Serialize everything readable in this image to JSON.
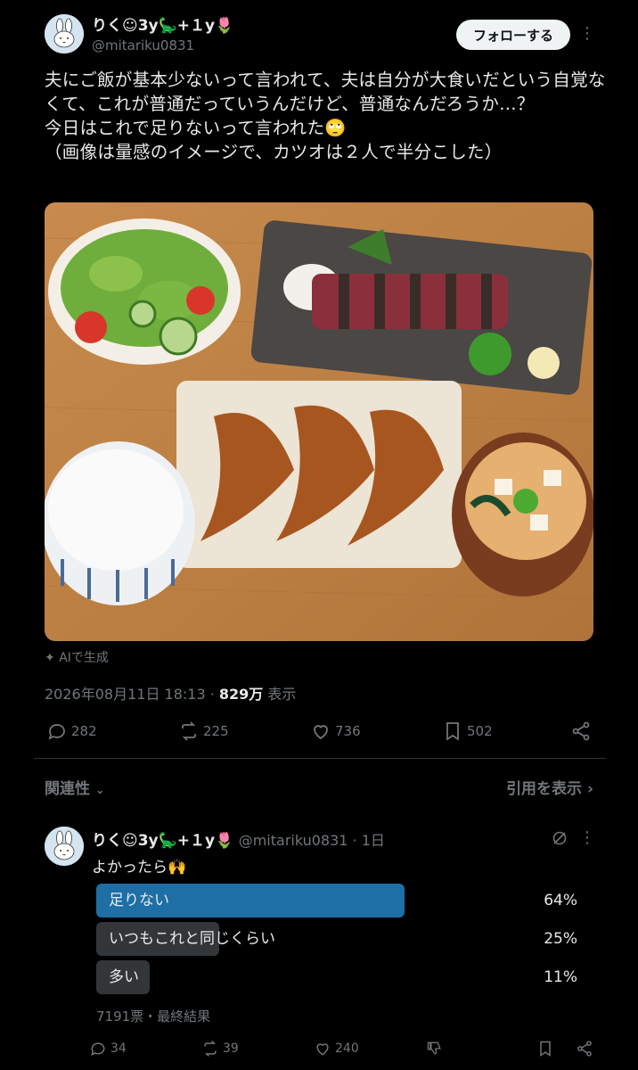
{
  "author": {
    "display_name": "りく☺︎3y🦕+１y🌷",
    "handle": "@mitariku0831",
    "follow_label": "フォローする"
  },
  "tweet": {
    "text": "夫にご飯が基本少ないって言われて、夫は自分が大食いだという自覚なくて、これが普通だっていうんだけど、普通なんだろうか…？\n今日はこれで足りないって言われた🙄\n（画像は量感のイメージで、カツオは２人で半分こした）",
    "ai_label": "AIで生成",
    "timestamp": "2026年08月11日 18:13",
    "views_count": "829万",
    "views_label": "表示",
    "stats": {
      "replies": "282",
      "reposts": "225",
      "likes": "736",
      "bookmarks": "502"
    }
  },
  "replies_section": {
    "sort_label": "関連性",
    "quotes_label": "引用を表示"
  },
  "reply": {
    "display_name": "りく☺︎3y🦕+１y🌷",
    "handle": "@mitariku0831",
    "time": "1日",
    "text": "よかったら🙌",
    "poll": {
      "options": [
        {
          "label": "足りない",
          "percent": "64%",
          "fraction": 0.64,
          "winner": true
        },
        {
          "label": "いつもこれと同じくらい",
          "percent": "25%",
          "fraction": 0.25,
          "winner": false
        },
        {
          "label": "多い",
          "percent": "11%",
          "fraction": 0.11,
          "winner": false
        }
      ],
      "footer": "7191票・最終結果"
    },
    "stats": {
      "replies": "34",
      "reposts": "39",
      "likes": "240"
    }
  },
  "colors": {
    "background": "#000000",
    "poll_winner": "#1d6fa5",
    "poll_other": "#333639",
    "muted": "#71767b"
  }
}
